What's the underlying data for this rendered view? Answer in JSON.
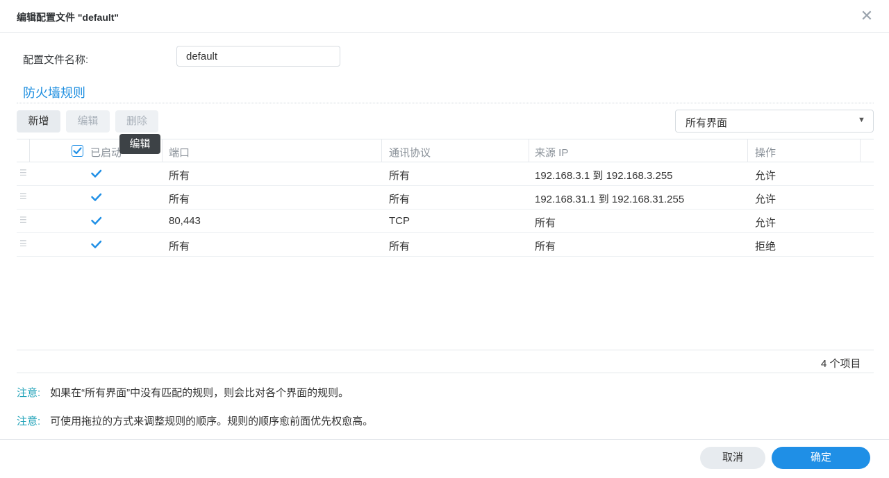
{
  "dialog": {
    "title": "编辑配置文件 \"default\"",
    "close_symbol": "✕"
  },
  "form": {
    "name_label": "配置文件名称:",
    "name_value": "default"
  },
  "section": {
    "title": "防火墙规则"
  },
  "toolbar": {
    "add_label": "新增",
    "edit_label": "编辑",
    "delete_label": "删除",
    "interface_selected": "所有界面"
  },
  "tooltip": {
    "text": "编辑"
  },
  "table": {
    "headers": {
      "enabled": "已启动",
      "port": "端口",
      "protocol": "通讯协议",
      "source_ip": "来源 IP",
      "action": "操作"
    },
    "rows": [
      {
        "port": "所有",
        "protocol": "所有",
        "source_ip": "192.168.3.1 到 192.168.3.255",
        "action": "允许"
      },
      {
        "port": "所有",
        "protocol": "所有",
        "source_ip": "192.168.31.1 到 192.168.31.255",
        "action": "允许"
      },
      {
        "port": "80,443",
        "protocol": "TCP",
        "source_ip": "所有",
        "action": "允许"
      },
      {
        "port": "所有",
        "protocol": "所有",
        "source_ip": "所有",
        "action": "拒绝"
      }
    ],
    "count_text": "4 个项目"
  },
  "notes": [
    {
      "key": "注意:",
      "text": "如果在“所有界面”中没有匹配的规则，则会比对各个界面的规则。"
    },
    {
      "key": "注意:",
      "text": "可使用拖拉的方式来调整规则的顺序。规则的顺序愈前面优先权愈高。"
    }
  ],
  "footer": {
    "cancel_label": "取消",
    "ok_label": "确定"
  },
  "colors": {
    "accent": "#1f8fe6",
    "note_key": "#1fa2b8"
  }
}
